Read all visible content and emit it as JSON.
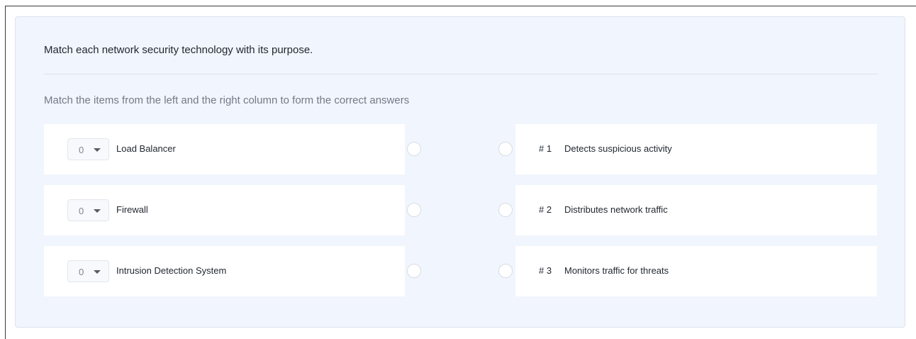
{
  "question": "Match each network security technology with its purpose.",
  "instruction": "Match the items from the left and the right column to form the correct answers",
  "left_items": [
    {
      "selected": "0",
      "label": "Load Balancer"
    },
    {
      "selected": "0",
      "label": "Firewall"
    },
    {
      "selected": "0",
      "label": "Intrusion Detection System"
    }
  ],
  "right_items": [
    {
      "number": "# 1",
      "text": "Detects suspicious activity"
    },
    {
      "number": "# 2",
      "text": "Distributes network traffic"
    },
    {
      "number": "# 3",
      "text": "Monitors traffic for threats"
    }
  ],
  "icons": {
    "dropdown": "caret-down-icon",
    "connector": "circle-connector"
  },
  "colors": {
    "card_background": "#f1f5fd",
    "row_background": "#ffffff",
    "text": "#222831",
    "muted_text": "#737b86"
  }
}
